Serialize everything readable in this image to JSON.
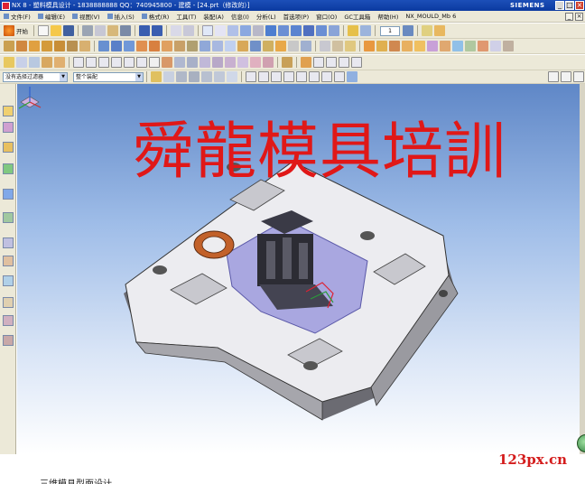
{
  "window": {
    "title": "NX 8 - 塑料模具设计 - 1838888888 QQ：740945800 - 建模 - [24.prt（修改的）]",
    "brand": "SIEMENS",
    "controls": [
      "_",
      "□",
      "×"
    ]
  },
  "menubar": {
    "items": [
      "文件(F)",
      "编辑(E)",
      "视图(V)",
      "插入(S)",
      "格式(R)",
      "工具(T)",
      "装配(A)",
      "信息(I)",
      "分析(L)",
      "首选项(P)",
      "窗口(O)",
      "GC工具箱",
      "帮助(H)",
      "NX_MOULD_Mb 6"
    ]
  },
  "toolbar1": {
    "start_label": "开始",
    "spin_value": "1"
  },
  "toolbar4": {
    "filter_value": "没有选择过滤器",
    "scope_value": "整个装配"
  },
  "viewport": {
    "overlay_title": "舜龍模具培訓"
  },
  "watermark": "123px.cn",
  "bottom_caption": "三维模具型面设计",
  "colors": {
    "accent": "#0b3aa0",
    "overlay_red": "#e01818",
    "mold_surface": "#e8e8ec",
    "core_highlight": "#a9a7e0",
    "copper_bushing": "#c2612a"
  }
}
